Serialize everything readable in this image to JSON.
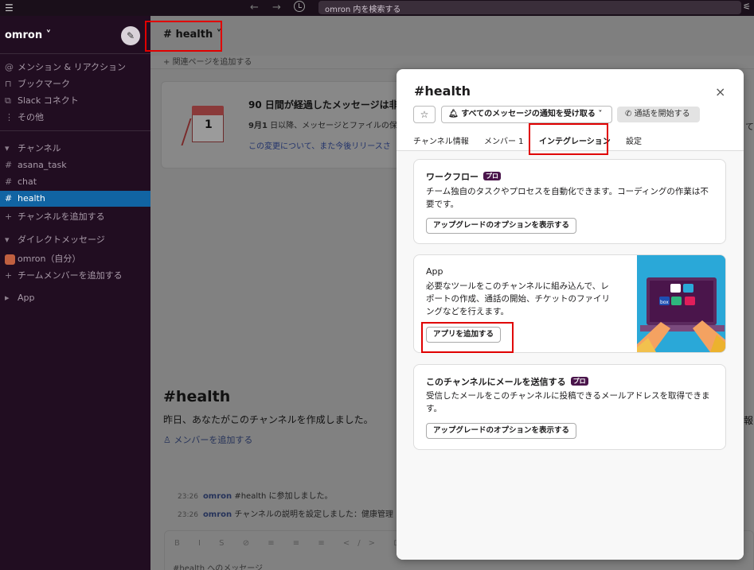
{
  "topbar": {
    "search_placeholder": "omron 内を検索する"
  },
  "sidebar": {
    "workspace": "omron",
    "nav": [
      {
        "label": "メンション & リアクション",
        "icon": "@"
      },
      {
        "label": "ブックマーク",
        "icon": "⊓"
      },
      {
        "label": "Slack コネクト",
        "icon": "⧉"
      },
      {
        "label": "その他",
        "icon": "⋮"
      }
    ],
    "channels_header": "チャンネル",
    "channels": [
      "asana_task",
      "chat",
      "health"
    ],
    "add_channel": "チャンネルを追加する",
    "dm_header": "ダイレクトメッセージ",
    "dm_user": "omron",
    "dm_self": "（自分）",
    "add_member": "チームメンバーを追加する",
    "app": "App"
  },
  "channel": {
    "hash": "#",
    "name": "health",
    "bookmark": "関連ページを追加する",
    "notice_title": "90 日間が経過したメッセージは非",
    "notice_date": "9月1",
    "notice_body": " 日以降、メッセージとファイルの保",
    "notice_link": "この変更について",
    "notice_link_tail": "、また今後リリースさ",
    "calendar_day": "1",
    "intro_desc": "昨日、あなたがこのチャンネルを作成しました。",
    "intro_add_member": "メンバーを追加する",
    "messages": [
      {
        "time": "23:26",
        "user": "omron",
        "text": " #health に参加しました。"
      },
      {
        "time": "23:26",
        "user": "omron",
        "text": " チャンネルの説明を設定しました：健康管理"
      }
    ],
    "composer_placeholder": "#health へのメッセージ",
    "composer_tools": "B I S ⊘ ≡ ≡ ≡ </> ⊡",
    "edge_text_1": "て",
    "edge_text_2": "報"
  },
  "modal": {
    "hash": "#",
    "title": "health",
    "close": "×",
    "star": "☆",
    "notify_label": "すべてのメッセージの通知を受け取る",
    "call_label": "通話を開始する",
    "tabs": [
      {
        "label": "チャンネル情報"
      },
      {
        "label": "メンバー 1"
      },
      {
        "label": "インテグレーション"
      },
      {
        "label": "設定"
      }
    ],
    "workflow": {
      "title": "ワークフロー",
      "badge": "プロ",
      "desc": "チーム独自のタスクやプロセスを自動化できます。コーディングの作業は不要です。",
      "button": "アップグレードのオプションを表示する"
    },
    "app": {
      "title": "App",
      "desc": "必要なツールをこのチャンネルに組み込んで、レポートの作成、通話の開始、チケットのファイリングなどを行えます。",
      "button": "アプリを追加する",
      "illus_label": "box"
    },
    "email": {
      "title": "このチャンネルにメールを送信する",
      "badge": "プロ",
      "desc": "受信したメールをこのチャンネルに投稿できるメールアドレスを取得できます。",
      "button": "アップグレードのオプションを表示する"
    }
  },
  "colors": {
    "sidebar": "#210d21",
    "active": "#1164a3",
    "annotation": "#e00000",
    "pro_badge": "#4a154b"
  }
}
